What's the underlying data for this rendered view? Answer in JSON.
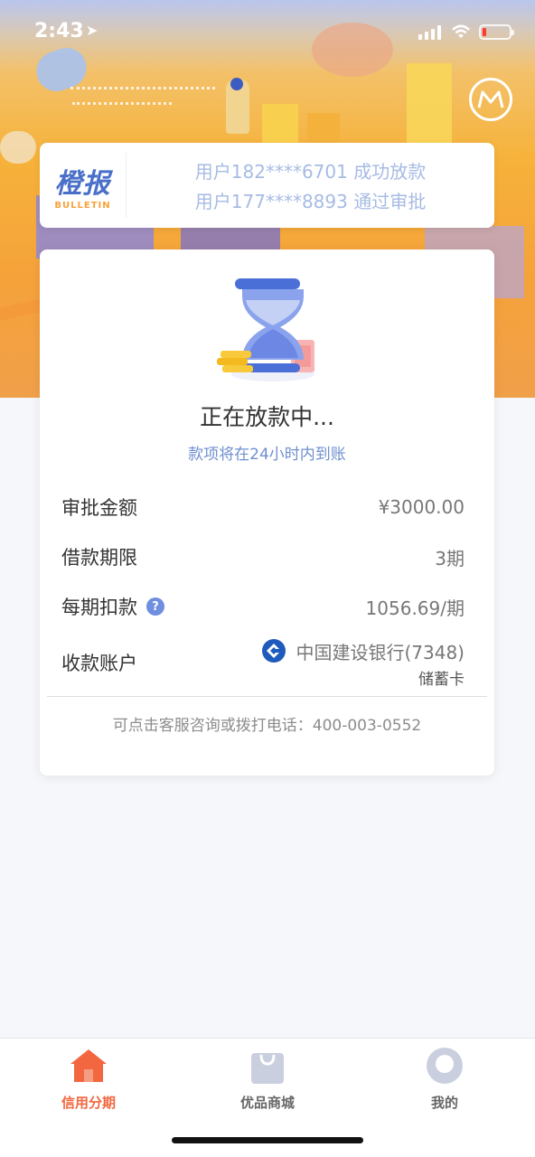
{
  "status_bar": {
    "time": "2:43"
  },
  "bulletin": {
    "logo_cn": "橙报",
    "logo_en": "BULLETIN",
    "messages": [
      "用户182****6701 成功放款",
      "用户177****8893 通过审批"
    ]
  },
  "loan": {
    "title": "正在放款中...",
    "subtitle": "款项将在24小时内到账",
    "rows": [
      {
        "label": "审批金额",
        "value": "¥3000.00"
      },
      {
        "label": "借款期限",
        "value": "3期"
      },
      {
        "label": "每期扣款",
        "value": "1056.69/期"
      },
      {
        "label": "收款账户",
        "value": "中国建设银行(7348)",
        "extra": "储蓄卡"
      }
    ],
    "hotline": "可点击客服咨询或拨打电话：400-003-0552"
  },
  "tabs": [
    {
      "label": "信用分期",
      "icon": "home-icon",
      "active": true
    },
    {
      "label": "优品商城",
      "icon": "shopping-bag-icon",
      "active": false
    },
    {
      "label": "我的",
      "icon": "profile-icon",
      "active": false
    }
  ],
  "colors": {
    "accent": "#f2673f",
    "primary_blue": "#4a6fc9",
    "muted_blue": "#a6bbe3"
  }
}
